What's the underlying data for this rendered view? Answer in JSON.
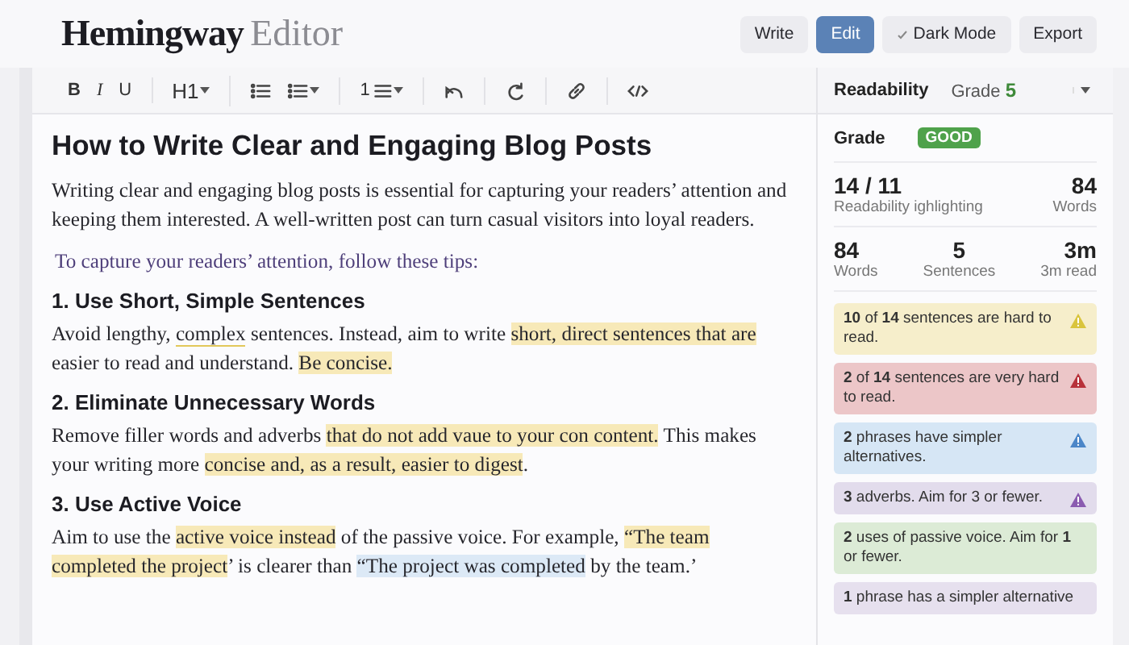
{
  "logo": {
    "main": "Hemingway",
    "sub": "Editor"
  },
  "header_buttons": [
    {
      "label": "Write",
      "selected": false,
      "check": false
    },
    {
      "label": "Edit",
      "selected": true,
      "check": false
    },
    {
      "label": "Dark Mode",
      "selected": false,
      "check": true
    },
    {
      "label": "Export",
      "selected": false,
      "check": false
    }
  ],
  "toolbar": [
    [
      {
        "kind": "bold",
        "label": "B"
      },
      {
        "kind": "italic",
        "label": "I"
      },
      {
        "kind": "underline",
        "label": "U"
      }
    ],
    [
      {
        "kind": "heading",
        "label": "H1",
        "dropdown": true
      }
    ],
    [
      {
        "kind": "bullets",
        "dropdown": false
      },
      {
        "kind": "bullets",
        "dropdown": true
      }
    ],
    [
      {
        "kind": "numbered",
        "label": "1",
        "dropdown": true
      }
    ],
    [
      {
        "kind": "undo"
      }
    ],
    [
      {
        "kind": "redo"
      }
    ],
    [
      {
        "kind": "link"
      }
    ],
    [
      {
        "kind": "code"
      }
    ]
  ],
  "document": {
    "title": "How to Write Clear and Engaging Blog Posts",
    "blocks": [
      {
        "kind": "paragraph",
        "segments": [
          {
            "kind": "plain",
            "text": "Writing clear and engaging blog posts is essential for capturing your readers’ attention and keeping them interested. A well-written post can turn casual visitors into loyal readers."
          }
        ]
      },
      {
        "kind": "lead",
        "segments": [
          {
            "kind": "plain",
            "text": "To capture your readers’ attention, follow these tips:"
          }
        ]
      },
      {
        "kind": "heading",
        "segments": [
          {
            "kind": "plain",
            "text": "1. Use Short, Simple Sentences"
          }
        ]
      },
      {
        "kind": "paragraph",
        "segments": [
          {
            "kind": "plain",
            "text": "Avoid lengthy, "
          },
          {
            "kind": "underline",
            "text": "complex"
          },
          {
            "kind": "plain",
            "text": " sentences. Instead, aim to write "
          },
          {
            "kind": "hard",
            "text": "short, direct sentences that are"
          },
          {
            "kind": "plain",
            "text": " easier to read and understand. "
          },
          {
            "kind": "hard",
            "text": "Be concise."
          }
        ]
      },
      {
        "kind": "heading",
        "segments": [
          {
            "kind": "plain",
            "text": "2. Eliminate Unnecessary Words"
          }
        ]
      },
      {
        "kind": "paragraph",
        "segments": [
          {
            "kind": "plain",
            "text": "Remove filler words and adverbs "
          },
          {
            "kind": "hard",
            "text": "that do not add vaue to your con content."
          },
          {
            "kind": "plain",
            "text": " This makes your writing more "
          },
          {
            "kind": "hard",
            "text": "concise and, as a result, easier to digest"
          },
          {
            "kind": "plain",
            "text": "."
          }
        ]
      },
      {
        "kind": "heading",
        "segments": [
          {
            "kind": "plain",
            "text": "3. Use Active Voice"
          }
        ]
      },
      {
        "kind": "paragraph",
        "segments": [
          {
            "kind": "plain",
            "text": "Aim to use the "
          },
          {
            "kind": "hard",
            "text": "active voice instead"
          },
          {
            "kind": "plain",
            "text": " of the passive voice. For example, "
          },
          {
            "kind": "hard",
            "text": "“The team completed the project"
          },
          {
            "kind": "plain",
            "text": "’ is clearer than "
          },
          {
            "kind": "passive",
            "text": "“The project was completed"
          },
          {
            "kind": "plain",
            "text": " by the team.’"
          }
        ]
      }
    ]
  },
  "sidebar": {
    "title": "Readability",
    "grade_label": "Grade",
    "grade_value": "5",
    "grade_row": {
      "label": "Grade",
      "badge": "GOOD"
    },
    "stats_top": [
      {
        "value": "14 / 11",
        "label": "Readability ighlighting"
      },
      {
        "value": "84",
        "label": "Words"
      }
    ],
    "stats_bottom": [
      {
        "value": "84",
        "label": "Words"
      },
      {
        "value": "5",
        "label": "Sentences"
      },
      {
        "value": "3m",
        "label": "3m read"
      }
    ],
    "cards": [
      {
        "text": "**10** of **14** sentences are hard to read.",
        "color": "#f6eecb",
        "kind": "hard"
      },
      {
        "text": "**2** of **14** sentences are very hard to read.",
        "color": "#ecc6c8",
        "kind": "very_hard"
      },
      {
        "text": "**2** phrases have simpler alternatives.",
        "color": "#d6e6f5",
        "kind": "simpler"
      },
      {
        "text": "**3** adverbs. Aim for 3 or fewer.",
        "color": "#e2dcec",
        "kind": "adverb"
      },
      {
        "text": "**2** uses of passive voice. Aim for **1** or fewer.",
        "color": "#dcebd6",
        "kind": "passive"
      },
      {
        "text": "**1** phrase has a simpler alternative",
        "color": "#e6e0ee",
        "kind": "phrase"
      }
    ]
  }
}
